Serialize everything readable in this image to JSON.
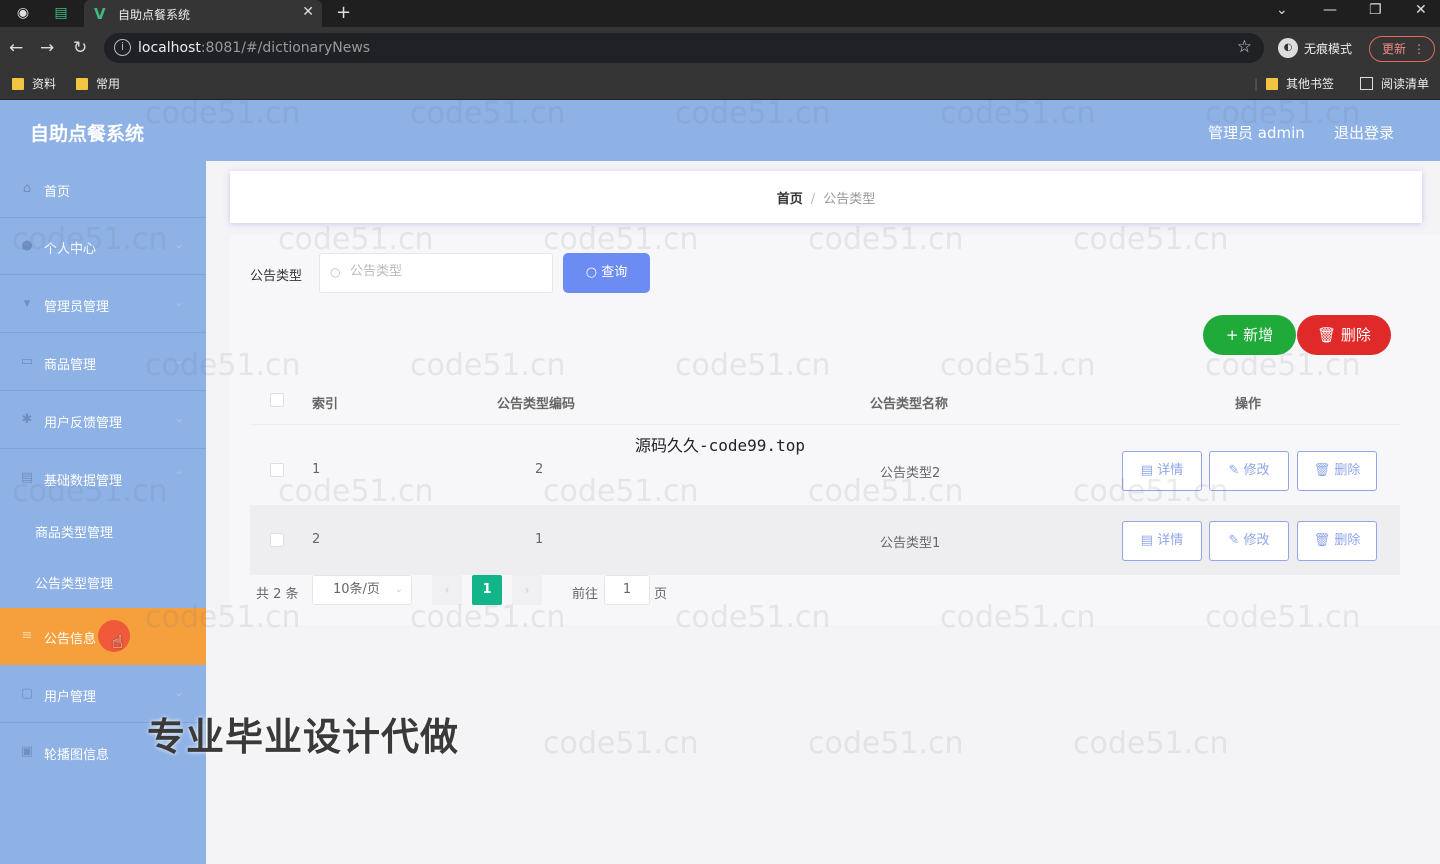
{
  "browser": {
    "tab_title": "自助点餐系统",
    "tab_logo": "V",
    "url_host": "localhost",
    "url_path": ":8081/#/dictionaryNews",
    "incognito_label": "无痕模式",
    "update_label": "更新",
    "bookmarks": [
      "资料",
      "常用"
    ],
    "bookmarks_right": [
      "其他书签",
      "阅读清单"
    ]
  },
  "header": {
    "title": "自助点餐系统",
    "admin_label": "管理员 admin",
    "logout_label": "退出登录"
  },
  "sidebar": {
    "items": [
      {
        "label": "首页",
        "icon": "home-icon",
        "arrow": false
      },
      {
        "label": "个人中心",
        "icon": "user-icon",
        "arrow": true
      },
      {
        "label": "管理员管理",
        "icon": "admin-icon",
        "arrow": true
      },
      {
        "label": "商品管理",
        "icon": "goods-icon",
        "arrow": true
      },
      {
        "label": "用户反馈管理",
        "icon": "feedback-icon",
        "arrow": true
      },
      {
        "label": "基础数据管理",
        "icon": "data-icon",
        "arrow": true
      }
    ],
    "subitems": [
      "商品类型管理",
      "公告类型管理"
    ],
    "items_after": [
      {
        "label": "公告信息",
        "icon": "notice-icon",
        "arrow": true,
        "active": true
      },
      {
        "label": "用户管理",
        "icon": "users-icon",
        "arrow": true
      },
      {
        "label": "轮播图信息",
        "icon": "carousel-icon",
        "arrow": false
      }
    ]
  },
  "breadcrumb": {
    "home": "首页",
    "separator": "/",
    "current": "公告类型"
  },
  "filter": {
    "label": "公告类型",
    "placeholder": "公告类型",
    "query_label": "查询"
  },
  "actions": {
    "add_label": "新增",
    "delete_label": "删除"
  },
  "table": {
    "headers": [
      "索引",
      "公告类型编码",
      "公告类型名称",
      "操作"
    ],
    "rows": [
      {
        "index": "1",
        "code": "2",
        "name": "公告类型2"
      },
      {
        "index": "2",
        "code": "1",
        "name": "公告类型1"
      }
    ],
    "op_labels": {
      "detail": "详情",
      "edit": "修改",
      "delete": "删除"
    }
  },
  "pagination": {
    "total": "共 2 条",
    "page_size": "10条/页",
    "current_page": "1",
    "goto_label": "前往",
    "goto_value": "1",
    "page_suffix": "页"
  },
  "overlays": {
    "watermark": "code51.cn",
    "mid_text": "源码久久-code99.top",
    "big_text": "专业毕业设计代做"
  },
  "colors": {
    "header_bg": "#8eb2e6",
    "active_menu": "#f6a03d",
    "query_btn": "#6c8cf4",
    "add_btn": "#1faa3a",
    "delete_btn": "#e02a2a",
    "page_active": "#12b48a"
  }
}
